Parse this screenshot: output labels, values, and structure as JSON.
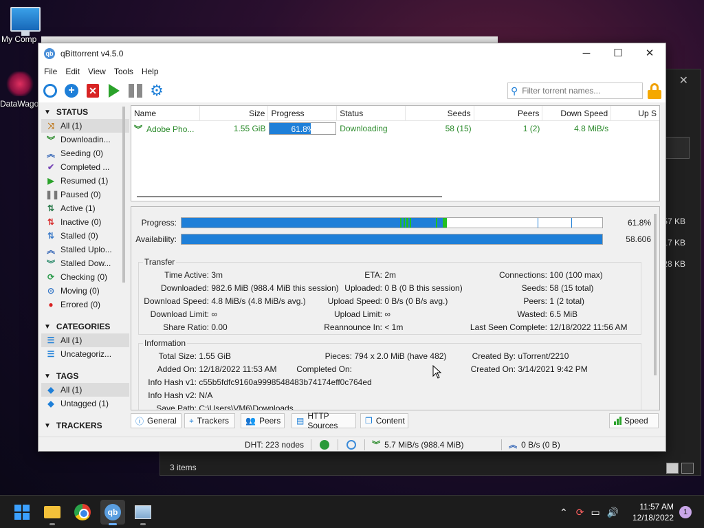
{
  "desktop": {
    "icons": [
      {
        "label": "My Comp",
        "icon": "monitor-icon"
      },
      {
        "label": "DataWago",
        "icon": "datawago-icon"
      }
    ]
  },
  "bg_window": {
    "sizes": [
      "57 KB",
      "17 KB",
      "28 KB"
    ],
    "status": "3 items"
  },
  "window": {
    "title": "qBittorrent v4.5.0",
    "app_icon_text": "qb",
    "controls": {
      "minimize": "─",
      "maximize": "☐",
      "close": "✕"
    }
  },
  "menu": [
    "File",
    "Edit",
    "View",
    "Tools",
    "Help"
  ],
  "toolbar": {
    "search_placeholder": "Filter torrent names..."
  },
  "sidebar": {
    "status_header": "STATUS",
    "status_items": [
      {
        "label": "All (1)",
        "icon": "shuffle-icon",
        "color": "#c07a20",
        "glyph": "⤨",
        "selected": true
      },
      {
        "label": "Downloadin...",
        "icon": "download-chevrons-icon",
        "color": "#2a8a2a",
        "glyph": "︾"
      },
      {
        "label": "Seeding (0)",
        "icon": "upload-chevrons-icon",
        "color": "#3a6ab8",
        "glyph": "︽"
      },
      {
        "label": "Completed ...",
        "icon": "checkmark-icon",
        "color": "#7a4ab8",
        "glyph": "✔"
      },
      {
        "label": "Resumed (1)",
        "icon": "play-icon",
        "color": "#2aa22a",
        "glyph": "▶"
      },
      {
        "label": "Paused (0)",
        "icon": "pause-icon",
        "color": "#777777",
        "glyph": "❚❚"
      },
      {
        "label": "Active (1)",
        "icon": "active-arrows-icon",
        "color": "#2a7a4a",
        "glyph": "⇅"
      },
      {
        "label": "Inactive (0)",
        "icon": "inactive-arrows-icon",
        "color": "#d83030",
        "glyph": "⇅"
      },
      {
        "label": "Stalled (0)",
        "icon": "stalled-arrows-icon",
        "color": "#3a7ac8",
        "glyph": "⇅"
      },
      {
        "label": "Stalled Uplo...",
        "icon": "stalled-upload-icon",
        "color": "#3a6ab8",
        "glyph": "︽"
      },
      {
        "label": "Stalled Dow...",
        "icon": "stalled-download-icon",
        "color": "#2a8a6a",
        "glyph": "︾"
      },
      {
        "label": "Checking (0)",
        "icon": "refresh-icon",
        "color": "#2a9a4a",
        "glyph": "⟳"
      },
      {
        "label": "Moving (0)",
        "icon": "moving-icon",
        "color": "#3a7ac8",
        "glyph": "⊙"
      },
      {
        "label": "Errored (0)",
        "icon": "error-icon",
        "color": "#d82020",
        "glyph": "●"
      }
    ],
    "categories_header": "CATEGORIES",
    "category_items": [
      {
        "label": "All (1)",
        "icon": "list-icon",
        "selected": true
      },
      {
        "label": "Uncategoriz...",
        "icon": "list-icon"
      }
    ],
    "tags_header": "TAGS",
    "tag_items": [
      {
        "label": "All (1)",
        "icon": "tag-icon",
        "selected": true
      },
      {
        "label": "Untagged (1)",
        "icon": "tag-icon"
      }
    ],
    "trackers_header": "TRACKERS"
  },
  "torrent_list": {
    "columns": [
      "Name",
      "Size",
      "Progress",
      "Status",
      "Seeds",
      "Peers",
      "Down Speed",
      "Up S"
    ],
    "rows": [
      {
        "name": "Adobe Pho...",
        "size": "1.55 GiB",
        "progress": 0.618,
        "progress_text": "61.8%",
        "status": "Downloading",
        "seeds": "58 (15)",
        "peers": "1 (2)",
        "down_speed": "4.8 MiB/s",
        "up_speed": ""
      }
    ]
  },
  "details": {
    "progress_label": "Progress:",
    "progress_value": "61.8%",
    "availability_label": "Availability:",
    "availability_value": "58.606",
    "transfer_title": "Transfer",
    "transfer": {
      "time_active_k": "Time Active:",
      "time_active_v": "3m",
      "downloaded_k": "Downloaded:",
      "downloaded_v": "982.6 MiB (988.4 MiB this session)",
      "dl_speed_k": "Download Speed:",
      "dl_speed_v": "4.8 MiB/s (4.8 MiB/s avg.)",
      "dl_limit_k": "Download Limit:",
      "dl_limit_v": "∞",
      "share_ratio_k": "Share Ratio:",
      "share_ratio_v": "0.00",
      "eta_k": "ETA:",
      "eta_v": "2m",
      "uploaded_k": "Uploaded:",
      "uploaded_v": "0 B (0 B this session)",
      "ul_speed_k": "Upload Speed:",
      "ul_speed_v": "0 B/s (0 B/s avg.)",
      "ul_limit_k": "Upload Limit:",
      "ul_limit_v": "∞",
      "reannounce_k": "Reannounce In:",
      "reannounce_v": "< 1m",
      "connections_k": "Connections:",
      "connections_v": "100 (100 max)",
      "seeds_k": "Seeds:",
      "seeds_v": "58 (15 total)",
      "peers_k": "Peers:",
      "peers_v": "1 (2 total)",
      "wasted_k": "Wasted:",
      "wasted_v": "6.5 MiB",
      "last_seen_k": "Last Seen Complete:",
      "last_seen_v": "12/18/2022 11:56 AM"
    },
    "information_title": "Information",
    "information": {
      "total_size_k": "Total Size:",
      "total_size_v": "1.55 GiB",
      "added_on_k": "Added On:",
      "added_on_v": "12/18/2022 11:53 AM",
      "hash_v1_k": "Info Hash v1:",
      "hash_v1_v": "c55b5fdfc9160a9998548483b74174eff0c764ed",
      "hash_v2_k": "Info Hash v2:",
      "hash_v2_v": "N/A",
      "save_path_k": "Save Path:",
      "save_path_v": "C:\\Users\\VM6\\Downloads",
      "pieces_k": "Pieces:",
      "pieces_v": "794 x 2.0 MiB (have 482)",
      "completed_on_k": "Completed On:",
      "completed_on_v": "",
      "created_by_k": "Created By:",
      "created_by_v": "uTorrent/2210",
      "created_on_k": "Created On:",
      "created_on_v": "3/14/2021 9:42 PM"
    }
  },
  "tabs": {
    "general": "General",
    "trackers": "Trackers",
    "peers": "Peers",
    "http_sources": "HTTP Sources",
    "content": "Content",
    "speed": "Speed"
  },
  "statusbar": {
    "dht": "DHT: 223 nodes",
    "down": "5.7 MiB/s (988.4 MiB)",
    "up": "0 B/s (0 B)"
  },
  "taskbar": {
    "time": "11:57 AM",
    "date": "12/18/2022",
    "notifications": "1"
  },
  "colors": {
    "accent": "#1e7fd8",
    "downloading_text": "#2a8a2a",
    "availability_bar": "#1e7fd8",
    "piece_green": "#22c022"
  }
}
